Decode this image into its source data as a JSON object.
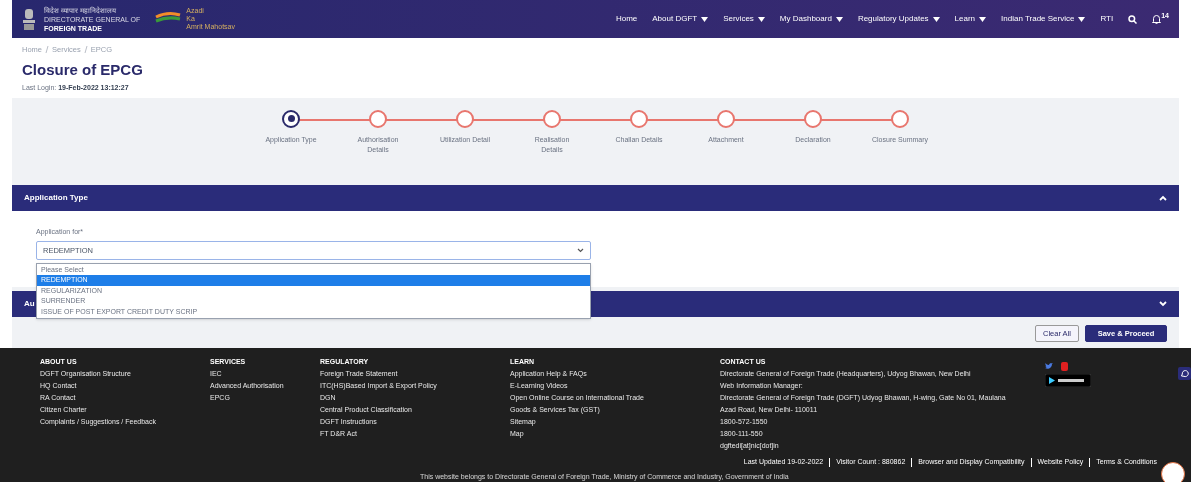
{
  "header": {
    "logo_lines": [
      "विदेश व्यापार महानिदेशालय",
      "DIRECTORATE GENERAL OF",
      "FOREIGN TRADE"
    ],
    "azadi_lines": [
      "Azadi",
      "Ka",
      "Amrit Mahotsav"
    ],
    "nav": [
      {
        "label": "Home",
        "dropdown": false
      },
      {
        "label": "About DGFT",
        "dropdown": true
      },
      {
        "label": "Services",
        "dropdown": true
      },
      {
        "label": "My Dashboard",
        "dropdown": true
      },
      {
        "label": "Regulatory Updates",
        "dropdown": true
      },
      {
        "label": "Learn",
        "dropdown": true
      },
      {
        "label": "Indian Trade Service",
        "dropdown": true
      },
      {
        "label": "RTI",
        "dropdown": false
      }
    ],
    "notification_count": "14"
  },
  "breadcrumb": [
    "Home",
    "Services",
    "EPCG"
  ],
  "page_title": "Closure of EPCG",
  "last_login": {
    "label": "Last Login:",
    "value": "19-Feb-2022 13:12:27"
  },
  "steps": [
    {
      "label": "Application Type",
      "selected": true
    },
    {
      "label": "Authorisation Details",
      "selected": false
    },
    {
      "label": "Utilization Detail",
      "selected": false
    },
    {
      "label": "Realisation Details",
      "selected": false
    },
    {
      "label": "Challan Details",
      "selected": false
    },
    {
      "label": "Attachment",
      "selected": false
    },
    {
      "label": "Declaration",
      "selected": false
    },
    {
      "label": "Closure Summary",
      "selected": false
    }
  ],
  "application_panel": {
    "title": "Application Type",
    "expanded": true,
    "field_label": "Application for*",
    "value": "REDEMPTION",
    "options": [
      {
        "label": "Please Select",
        "selected": false
      },
      {
        "label": "REDEMPTION",
        "selected": true
      },
      {
        "label": "REGULARIZATION",
        "selected": false
      },
      {
        "label": "SURRENDER",
        "selected": false
      },
      {
        "label": "ISSUE OF POST EXPORT CREDIT DUTY SCRIP",
        "selected": false
      }
    ]
  },
  "second_panel": {
    "title": "Au",
    "expanded": false
  },
  "buttons": [
    {
      "label": "Clear All",
      "kind": "secondary"
    },
    {
      "label": "Save & Proceed",
      "kind": "primary"
    }
  ],
  "footer": {
    "columns": [
      {
        "title": "ABOUT US",
        "links": [
          "DGFT Organisation Structure",
          "HQ Contact",
          "RA Contact",
          "Citizen Charter",
          "Complaints / Suggestions / Feedback"
        ]
      },
      {
        "title": "SERVICES",
        "links": [
          "IEC",
          "Advanced Authorisation",
          "EPCG"
        ]
      },
      {
        "title": "REGULATORY",
        "links": [
          "Foreign Trade Statement",
          "ITC(HS)Based Import & Export Policy",
          "DGN",
          "Central Product Classification",
          "DGFT Instructions",
          "FT D&R Act"
        ]
      },
      {
        "title": "LEARN",
        "links": [
          "Application Help & FAQs",
          "E-Learning Videos",
          "Open Online Course on International Trade",
          "Goods & Services Tax (GST)",
          "Sitemap",
          "Map"
        ]
      },
      {
        "title": "CONTACT US",
        "links": [
          "Directorate General of Foreign Trade (Headquarters), Udyog Bhawan, New Delhi",
          "Web Information Manager:",
          "Directorate General of Foreign Trade (DGFT) Udyog Bhawan, H-wing, Gate No 01, Maulana",
          "Azad Road, New Delhi- 110011",
          "1800-572-1550",
          "1800-111-550",
          "dgftedi[at]nic[dot]in"
        ]
      }
    ],
    "bottom_links": [
      "Last Updated 19-02-2022",
      "Visitor Count : 880862",
      "Browser and Display Compatibility",
      "Website Policy",
      "Terms & Conditions"
    ],
    "ownership": "This website belongs to Directorate General of Foreign Trade, Ministry of Commerce and Industry, Government of India"
  }
}
